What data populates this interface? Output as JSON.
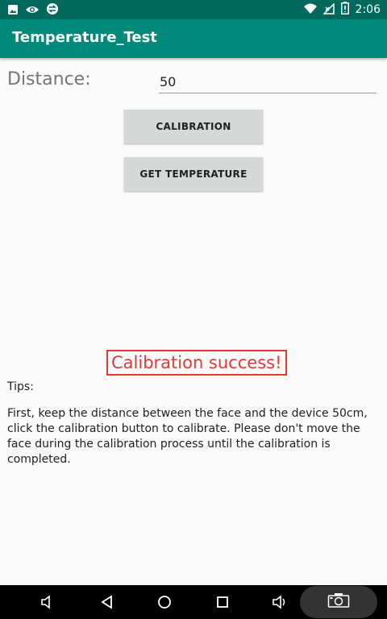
{
  "status_bar": {
    "time": "2:06",
    "left_icons": [
      "image-icon",
      "eye-icon",
      "remote-icon"
    ],
    "right_icons": [
      "wifi-icon",
      "no-signal-icon",
      "battery-icon"
    ]
  },
  "app_bar": {
    "title": "Temperature_Test"
  },
  "form": {
    "distance_label": "Distance:",
    "distance_value": "50"
  },
  "buttons": {
    "calibration": "CALIBRATION",
    "get_temperature": "GET TEMPERATURE"
  },
  "result": {
    "message": "Calibration success!",
    "color": "#e53935"
  },
  "tips": {
    "label": "Tips:",
    "text": "First, keep the distance between the face and the device 50cm, click the calibration button to calibrate. Please don't move the face during the calibration process until the calibration is completed."
  },
  "nav_bar": {
    "icons": [
      "volume-down-icon",
      "back-icon",
      "home-icon",
      "recents-icon",
      "volume-up-icon",
      "screenshot-icon"
    ]
  },
  "colors": {
    "status_bar": "#00695c",
    "app_bar": "#00897b",
    "button": "#d6d7d7"
  }
}
